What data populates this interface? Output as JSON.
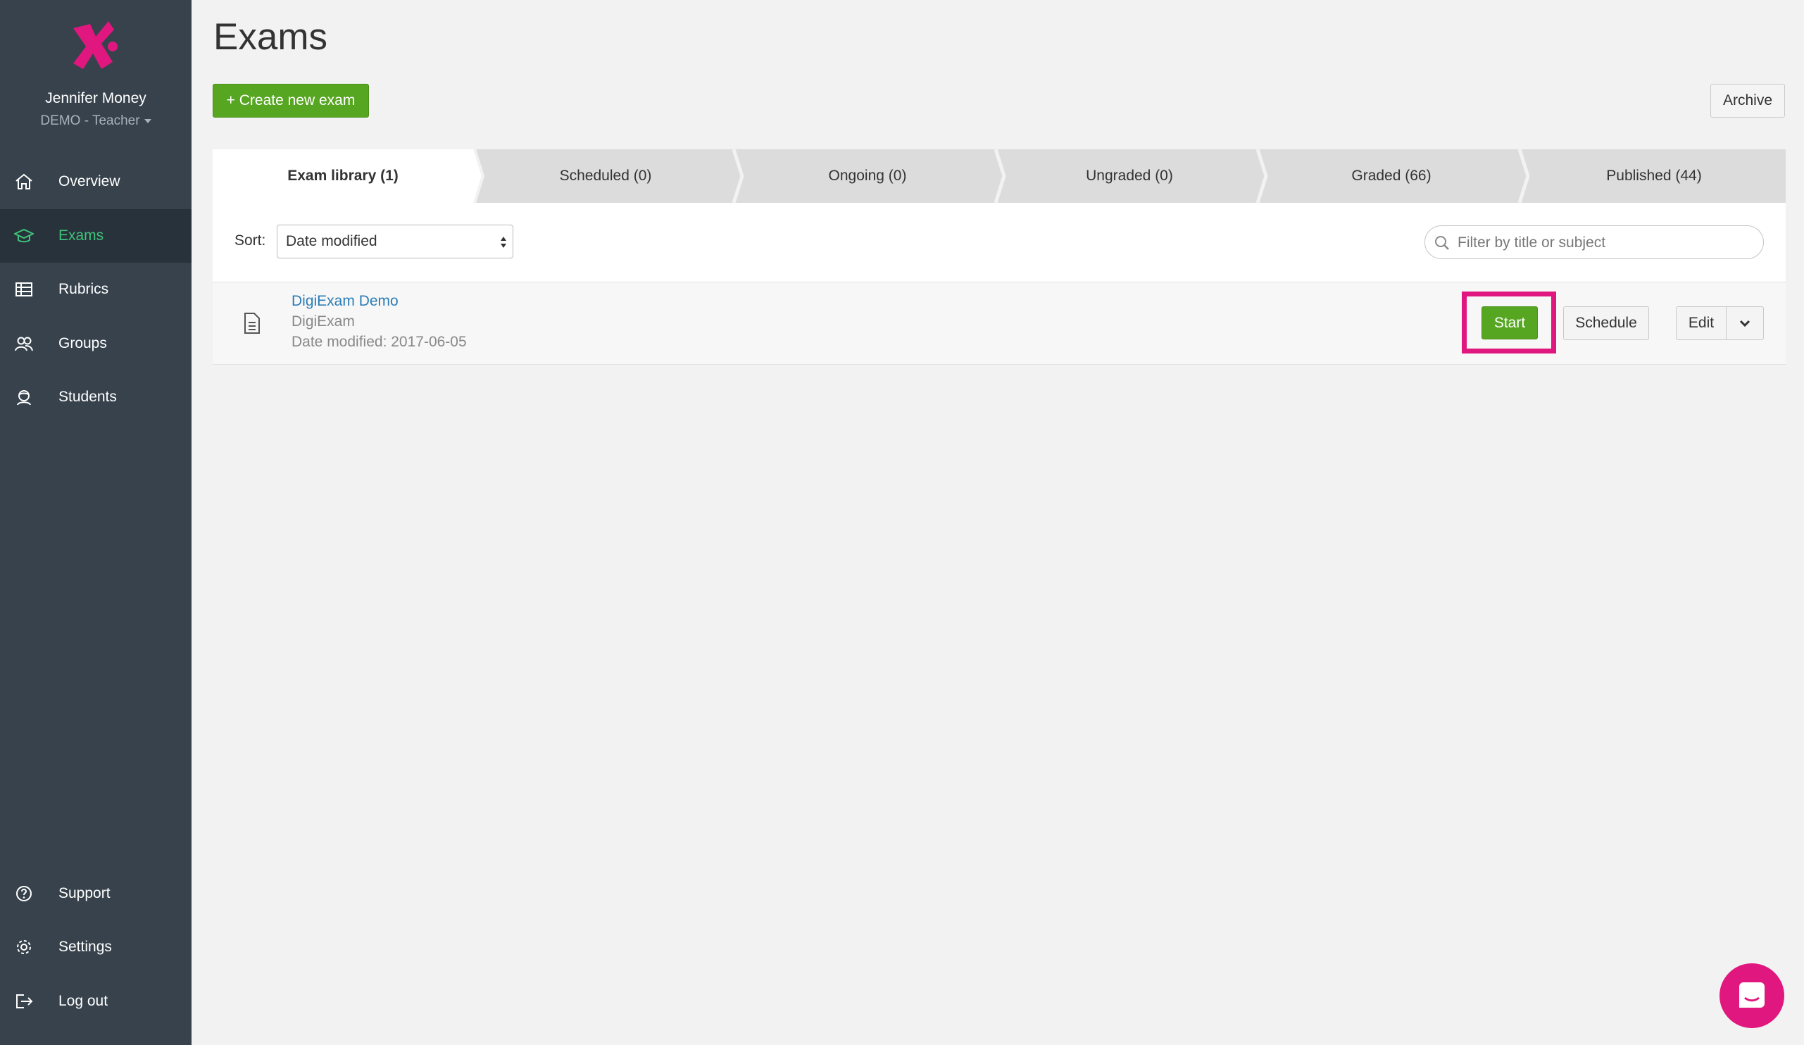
{
  "user": {
    "name": "Jennifer Money",
    "role": "DEMO - Teacher"
  },
  "nav": {
    "items": [
      {
        "label": "Overview",
        "icon": "home-icon"
      },
      {
        "label": "Exams",
        "icon": "graduation-cap-icon",
        "active": true
      },
      {
        "label": "Rubrics",
        "icon": "grid-icon"
      },
      {
        "label": "Groups",
        "icon": "users-icon"
      },
      {
        "label": "Students",
        "icon": "student-icon"
      }
    ],
    "bottom_items": [
      {
        "label": "Support",
        "icon": "help-circle-icon"
      },
      {
        "label": "Settings",
        "icon": "gear-icon"
      },
      {
        "label": "Log out",
        "icon": "logout-icon"
      }
    ]
  },
  "page": {
    "title": "Exams"
  },
  "toolbar": {
    "create_label": "+ Create new exam",
    "archive_label": "Archive"
  },
  "tabs": [
    {
      "label": "Exam library (1)",
      "active": true
    },
    {
      "label": "Scheduled (0)"
    },
    {
      "label": "Ongoing (0)"
    },
    {
      "label": "Ungraded (0)"
    },
    {
      "label": "Graded (66)"
    },
    {
      "label": "Published (44)"
    }
  ],
  "sort": {
    "label": "Sort:",
    "value": "Date modified"
  },
  "filter": {
    "placeholder": "Filter by title or subject"
  },
  "exams": [
    {
      "title": "DigiExam Demo",
      "subject": "DigiExam",
      "date_modified": "Date modified: 2017-06-05",
      "actions": {
        "start": "Start",
        "schedule": "Schedule",
        "edit": "Edit"
      }
    }
  ],
  "colors": {
    "sidebar": "#37424c",
    "accent_green": "#57a622",
    "active_nav": "#3fc47a",
    "brand_pink": "#e0177e",
    "link_blue": "#2a7db6"
  }
}
